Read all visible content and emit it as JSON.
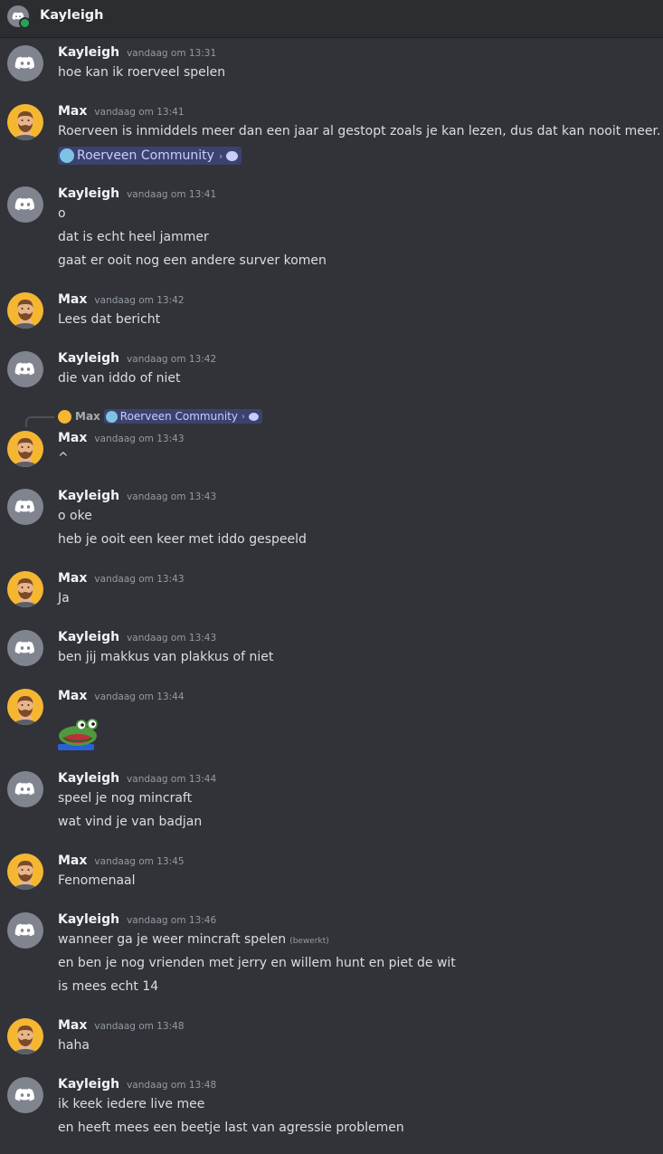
{
  "header": {
    "title": "Kayleigh",
    "status_color": "#23a55a"
  },
  "users": {
    "kayleigh": {
      "name": "Kayleigh",
      "avatar": "discord-default-icon"
    },
    "max": {
      "name": "Max",
      "avatar": "max-avatar"
    }
  },
  "channel_mention": {
    "label": "Roerveen Community",
    "chevron": "›"
  },
  "messages": [
    {
      "author": "Kayleigh",
      "time": "vandaag om 13:31",
      "lines": [
        "hoe kan ik roerveel spelen"
      ]
    },
    {
      "author": "Max",
      "time": "vandaag om 13:41",
      "lines": [
        "Roerveen is inmiddels meer dan een jaar al gestopt zoals je kan lezen, dus dat kan nooit meer."
      ]
    },
    {
      "author": "Kayleigh",
      "time": "vandaag om 13:41",
      "lines": [
        "o",
        "dat is echt heel jammer",
        "gaat er ooit nog een andere surver komen"
      ]
    },
    {
      "author": "Max",
      "time": "vandaag om 13:42",
      "lines": [
        "Lees dat bericht"
      ]
    },
    {
      "author": "Kayleigh",
      "time": "vandaag om 13:42",
      "lines": [
        "die van iddo of niet"
      ]
    },
    {
      "author": "Max",
      "time": "vandaag om 13:43",
      "reply_to": "Max",
      "lines": [
        "^"
      ]
    },
    {
      "author": "Kayleigh",
      "time": "vandaag om 13:43",
      "lines": [
        "o oke",
        "heb je ooit een keer met iddo gespeeld"
      ]
    },
    {
      "author": "Max",
      "time": "vandaag om 13:43",
      "lines": [
        "Ja"
      ]
    },
    {
      "author": "Kayleigh",
      "time": "vandaag om 13:43",
      "lines": [
        "ben jij makkus van plakkus of niet"
      ]
    },
    {
      "author": "Max",
      "time": "vandaag om 13:44",
      "emoji": "pepe-frog-emoji"
    },
    {
      "author": "Kayleigh",
      "time": "vandaag om 13:44",
      "lines": [
        "speel je nog mincraft",
        "wat vind je van badjan"
      ]
    },
    {
      "author": "Max",
      "time": "vandaag om 13:45",
      "lines": [
        "Fenomenaal"
      ]
    },
    {
      "author": "Kayleigh",
      "time": "vandaag om 13:46",
      "lines": [
        "wanneer ga je weer mincraft spelen",
        "en ben je nog vrienden met jerry en willem hunt en piet de wit",
        "is mees echt 14"
      ],
      "edited": "(bewerkt)"
    },
    {
      "author": "Max",
      "time": "vandaag om 13:48",
      "lines": [
        "haha"
      ]
    },
    {
      "author": "Kayleigh",
      "time": "vandaag om 13:48",
      "lines": [
        "ik keek iedere live mee",
        "en heeft mees een beetje last van agressie problemen"
      ]
    }
  ]
}
